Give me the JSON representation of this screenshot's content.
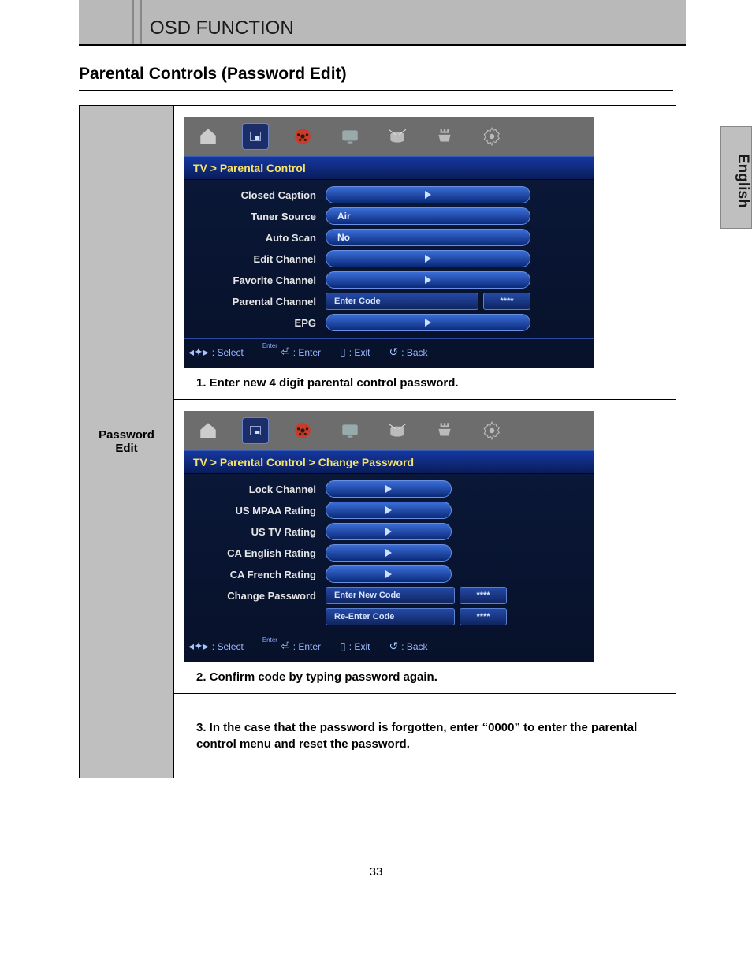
{
  "header": {
    "title": "OSD FUNCTION"
  },
  "sideTab": "English",
  "pageTitle": "Parental Controls (Password Edit)",
  "leftLabel": "Password Edit",
  "pageNumber": "33",
  "step1Text": "1. Enter new 4 digit parental control password.",
  "step2Text": "2. Confirm code by typing password again.",
  "step3Text": "3. In the case that the password is forgotten, enter “0000” to enter the parental control menu and reset the password.",
  "osd1": {
    "breadcrumb": "TV > Parental Control",
    "rows": [
      {
        "label": "Closed Caption",
        "type": "arrow"
      },
      {
        "label": "Tuner Source",
        "type": "text",
        "value": "Air"
      },
      {
        "label": "Auto Scan",
        "type": "text",
        "value": "No"
      },
      {
        "label": "Edit Channel",
        "type": "arrow"
      },
      {
        "label": "Favorite Channel",
        "type": "arrow"
      },
      {
        "label": "Parental Channel",
        "type": "code",
        "box1": "Enter Code",
        "box2": "****"
      },
      {
        "label": "EPG",
        "type": "arrow"
      }
    ],
    "footer": {
      "select": ": Select",
      "enter": ": Enter",
      "exit": ": Exit",
      "back": ": Back",
      "enterTop": "Enter"
    }
  },
  "osd2": {
    "breadcrumb": "TV > Parental Control > Change Password",
    "rows": [
      {
        "label": "Lock Channel",
        "type": "arrow_s"
      },
      {
        "label": "US MPAA Rating",
        "type": "arrow_s"
      },
      {
        "label": "US TV Rating",
        "type": "arrow_s"
      },
      {
        "label": "CA English Rating",
        "type": "arrow_s"
      },
      {
        "label": "CA French Rating",
        "type": "arrow_s"
      },
      {
        "label": "Change Password",
        "type": "code",
        "box1": "Enter New Code",
        "box2": "****"
      },
      {
        "label": "",
        "type": "code",
        "box1": "Re-Enter Code",
        "box2": "****"
      }
    ],
    "footer": {
      "select": ": Select",
      "enter": ": Enter",
      "exit": ": Exit",
      "back": ": Back",
      "enterTop": "Enter"
    }
  }
}
